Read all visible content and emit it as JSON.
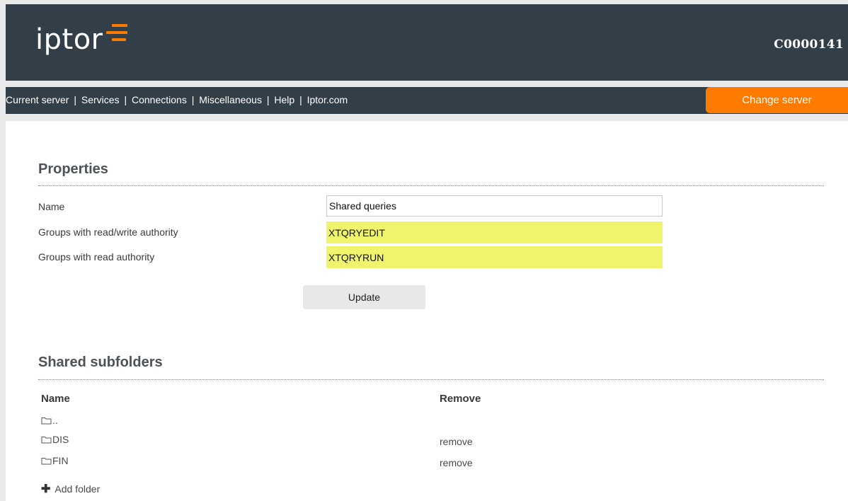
{
  "header": {
    "logo_text": "iptor",
    "server_id": "C0000141"
  },
  "nav": {
    "links": [
      "Current server",
      "Services",
      "Connections",
      "Miscellaneous",
      "Help",
      "Iptor.com"
    ],
    "separator": "|",
    "change_server_label": "Change server"
  },
  "properties": {
    "title": "Properties",
    "name_label": "Name",
    "name_value": "Shared queries",
    "rw_label": "Groups with read/write authority",
    "rw_value": "XTQRYEDIT",
    "read_label": "Groups with read authority",
    "read_value": "XTQRYRUN",
    "update_label": "Update"
  },
  "subfolders": {
    "title": "Shared subfolders",
    "col_name": "Name",
    "col_remove": "Remove",
    "rows": [
      {
        "name": "..",
        "remove": ""
      },
      {
        "name": "DIS",
        "remove": "remove"
      },
      {
        "name": "FIN",
        "remove": "remove"
      }
    ],
    "add_folder_label": "Add folder"
  },
  "icons": {
    "folder": "folder-icon",
    "plus": "plus-icon"
  },
  "colors": {
    "header_bg": "#333f48",
    "accent": "#ff7a00",
    "highlight": "#f0f46c"
  }
}
